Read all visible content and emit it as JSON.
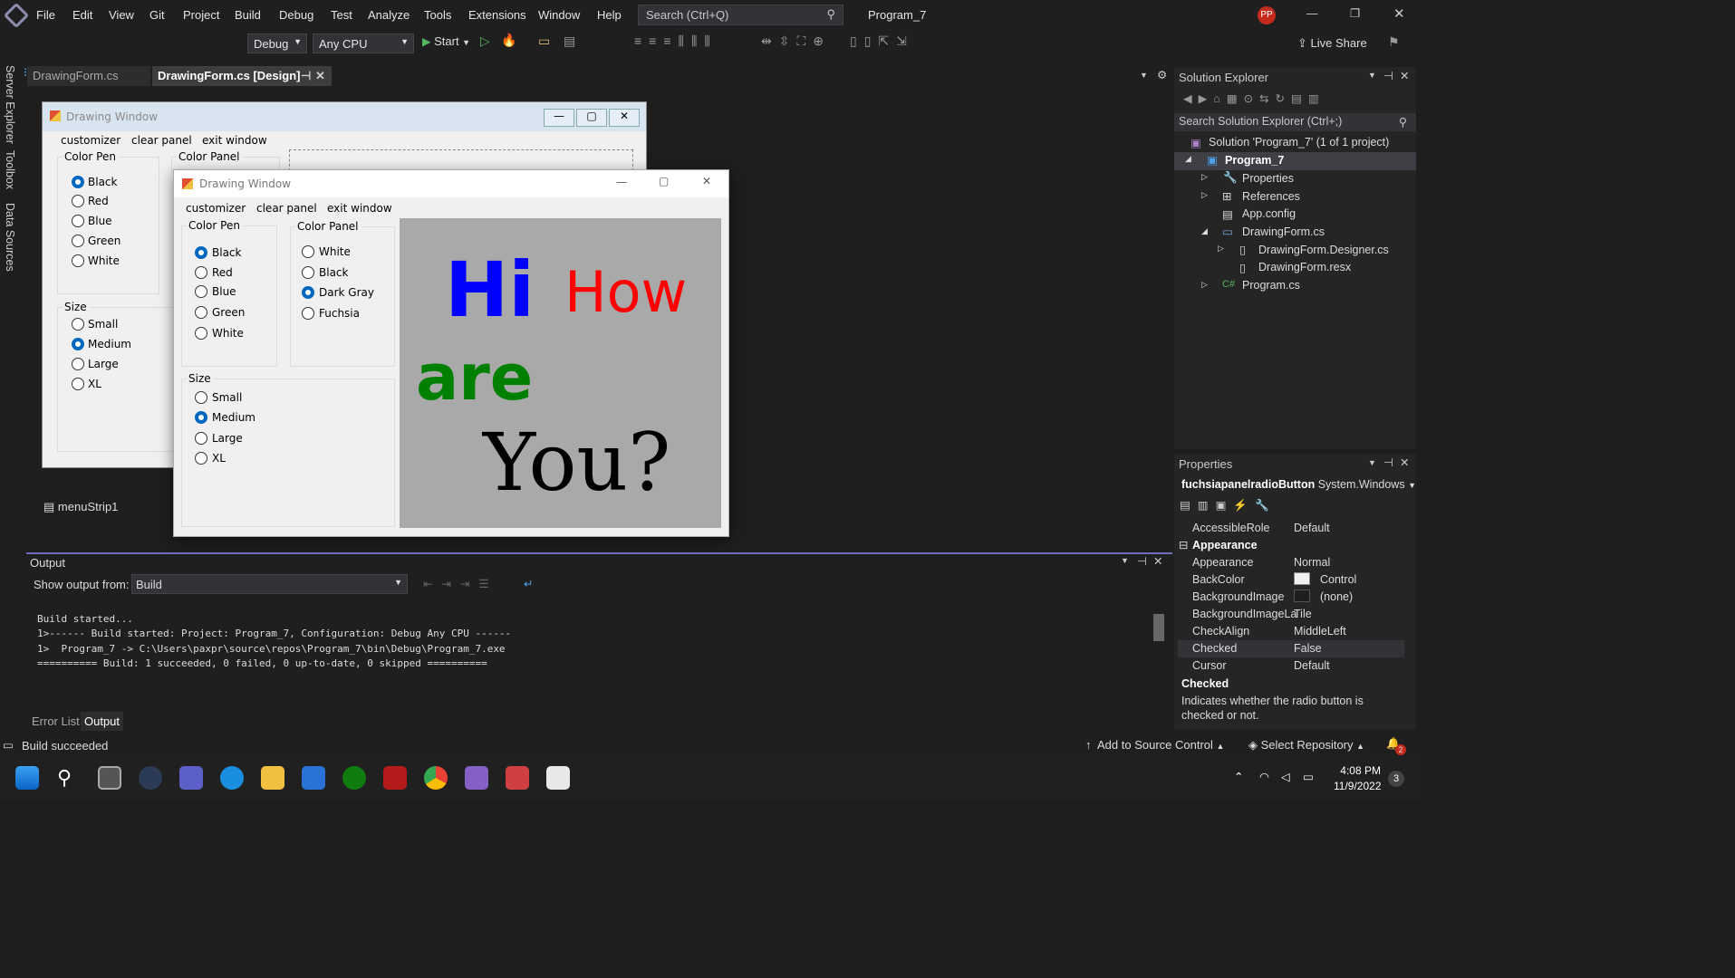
{
  "menubar": {
    "items": [
      "File",
      "Edit",
      "View",
      "Git",
      "Project",
      "Build",
      "Debug",
      "Test",
      "Analyze",
      "Tools",
      "Extensions",
      "Window",
      "Help"
    ],
    "search_placeholder": "Search (Ctrl+Q)",
    "solution_name": "Program_7",
    "user_initials": "PP"
  },
  "toolbar": {
    "config": "Debug",
    "platform": "Any CPU",
    "start_label": "Start",
    "live_share": "Live Share"
  },
  "left_rail": [
    "Server Explorer",
    "Toolbox",
    "Data Sources"
  ],
  "doc_tabs": [
    {
      "label": "DrawingForm.cs"
    },
    {
      "label": "DrawingForm.cs [Design]"
    }
  ],
  "designer": {
    "title": "Drawing Window",
    "menu": [
      "customizer",
      "clear panel",
      "exit window"
    ],
    "color_pen": "Color Pen",
    "color_panel": "Color Panel",
    "size": "Size",
    "pen_colors": [
      "Black",
      "Red",
      "Blue",
      "Green",
      "White"
    ],
    "sizes": [
      "Small",
      "Medium",
      "Large",
      "XL"
    ],
    "component_tray": "menuStrip1"
  },
  "runtime": {
    "title": "Drawing Window",
    "menu": [
      "customizer",
      "clear panel",
      "exit window"
    ],
    "color_pen": "Color Pen",
    "color_panel": "Color Panel",
    "size": "Size",
    "pen_colors": [
      "Black",
      "Red",
      "Blue",
      "Green",
      "White"
    ],
    "panel_colors": [
      "White",
      "Black",
      "Dark Gray",
      "Fuchsia"
    ],
    "sizes": [
      "Small",
      "Medium",
      "Large",
      "XL"
    ],
    "canvas_text": [
      {
        "text": "Hi",
        "color": "#0000ff"
      },
      {
        "text": "How",
        "color": "#ff0000"
      },
      {
        "text": "are",
        "color": "#008000"
      },
      {
        "text": "You?",
        "color": "#000000"
      }
    ]
  },
  "output": {
    "title": "Output",
    "show_from_label": "Show output from:",
    "source": "Build",
    "lines": [
      "Build started...",
      "1>------ Build started: Project: Program_7, Configuration: Debug Any CPU ------",
      "1>  Program_7 -> C:\\Users\\paxpr\\source\\repos\\Program_7\\bin\\Debug\\Program_7.exe",
      "========== Build: 1 succeeded, 0 failed, 0 up-to-date, 0 skipped =========="
    ],
    "tabs": [
      "Error List",
      "Output"
    ]
  },
  "solution_explorer": {
    "title": "Solution Explorer",
    "search": "Search Solution Explorer (Ctrl+;)",
    "items": [
      "Solution 'Program_7' (1 of 1 project)",
      "Program_7",
      "Properties",
      "References",
      "App.config",
      "DrawingForm.cs",
      "DrawingForm.Designer.cs",
      "DrawingForm.resx",
      "Program.cs"
    ]
  },
  "properties": {
    "title": "Properties",
    "object": "fuchsiapanelradioButton",
    "type": "System.Windows",
    "category": "Appearance",
    "rows": [
      [
        "AccessibleRole",
        "Default"
      ],
      [
        "Appearance",
        "Normal"
      ],
      [
        "BackColor",
        "Control"
      ],
      [
        "BackgroundImage",
        "(none)"
      ],
      [
        "BackgroundImageLa",
        "Tile"
      ],
      [
        "CheckAlign",
        "MiddleLeft"
      ],
      [
        "Checked",
        "False"
      ],
      [
        "Cursor",
        "Default"
      ]
    ],
    "desc_title": "Checked",
    "desc_text": "Indicates whether the radio button is checked or not."
  },
  "status": {
    "left": "Build succeeded",
    "source_control": "Add to Source Control",
    "repo": "Select Repository",
    "notifications": "2"
  },
  "taskbar": {
    "time": "4:08 PM",
    "date": "11/9/2022",
    "badge": "3"
  }
}
